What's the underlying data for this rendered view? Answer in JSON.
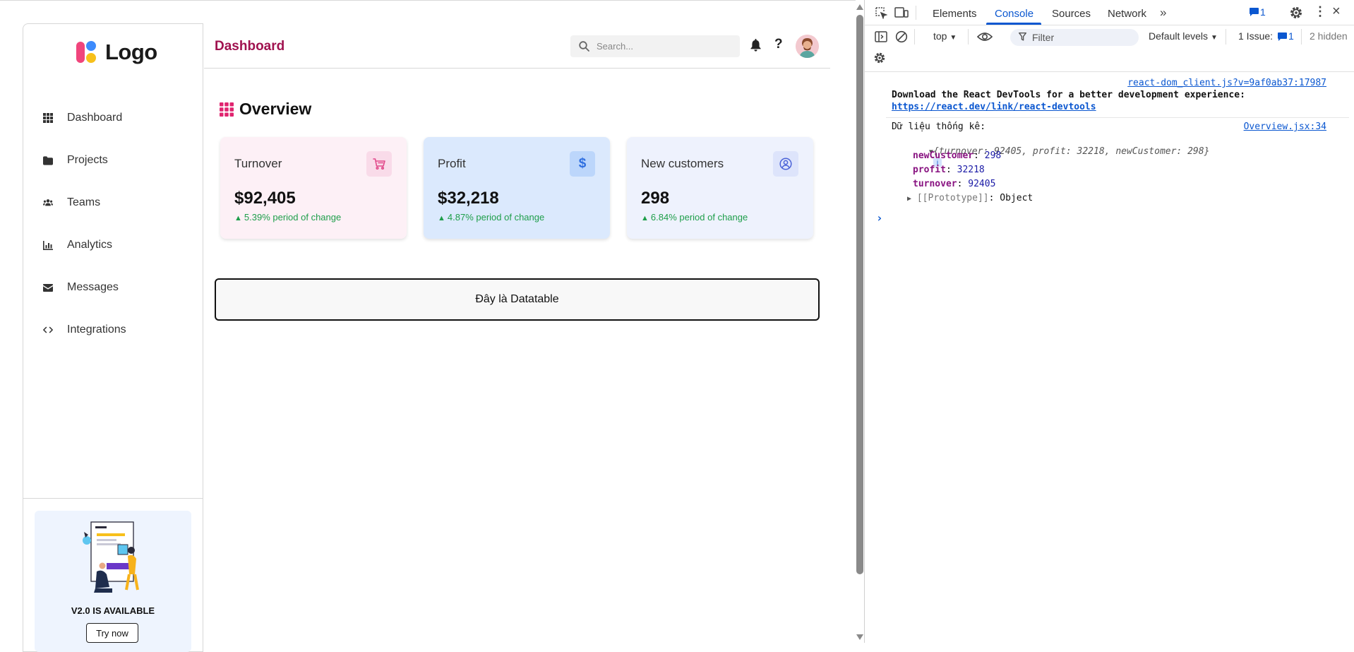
{
  "app": {
    "logo_text": "Logo",
    "nav": [
      {
        "label": "Dashboard",
        "icon": "grid-icon"
      },
      {
        "label": "Projects",
        "icon": "folder-icon"
      },
      {
        "label": "Teams",
        "icon": "users-icon"
      },
      {
        "label": "Analytics",
        "icon": "bar-chart-icon"
      },
      {
        "label": "Messages",
        "icon": "envelope-icon"
      },
      {
        "label": "Integrations",
        "icon": "code-icon"
      }
    ],
    "promo": {
      "title": "V2.0 IS AVAILABLE",
      "button": "Try now"
    },
    "header": {
      "title": "Dashboard",
      "search_placeholder": "Search...",
      "help_glyph": "?"
    },
    "overview": {
      "title": "Overview",
      "cards": [
        {
          "title": "Turnover",
          "value": "$92,405",
          "change": "5.39% period of change",
          "icon": "cart-icon",
          "bg": "#fdf0f6",
          "icon_bg": "#f9dbe9",
          "icon_color": "#e24a8b"
        },
        {
          "title": "Profit",
          "value": "$32,218",
          "change": "4.87% period of change",
          "icon": "dollar-icon",
          "bg": "#dbe9fd",
          "icon_bg": "#bcd6fb",
          "icon_color": "#2f6fe0"
        },
        {
          "title": "New customers",
          "value": "298",
          "change": "6.84% period of change",
          "icon": "user-circle-icon",
          "bg": "#eef2fd",
          "icon_bg": "#dde4fb",
          "icon_color": "#4b63d8"
        }
      ]
    },
    "datatable_label": "Đây là Datatable",
    "accent_color": "#a0124f",
    "positive_color": "#1e9e4a"
  },
  "devtools": {
    "tabs": [
      "Elements",
      "Console",
      "Sources",
      "Network"
    ],
    "active_tab": "Console",
    "message_count": "1",
    "context": "top",
    "filter_placeholder": "Filter",
    "levels": "Default levels",
    "issue_label": "1 Issue:",
    "issue_count": "1",
    "hidden": "2 hidden",
    "console": {
      "source1": "react-dom_client.js?v=9af0ab37:17987",
      "devtools_msg": "Download the React DevTools for a better development experience:",
      "devtools_link": "https://react.dev/link/react-devtools",
      "log_label": "Dữ liệu thống kê:",
      "source2": "Overview.jsx:34",
      "object_preview": {
        "turnover_key": "turnover",
        "turnover": "92405",
        "profit_key": "profit",
        "profit": "32218",
        "newCustomer_key": "newCustomer",
        "newCustomer": "298"
      },
      "props": [
        {
          "key": "newCustomer",
          "value": "298"
        },
        {
          "key": "profit",
          "value": "32218"
        },
        {
          "key": "turnover",
          "value": "92405"
        }
      ],
      "prototype_label": "[[Prototype]]",
      "prototype_value": "Object",
      "prompt": "›"
    }
  }
}
